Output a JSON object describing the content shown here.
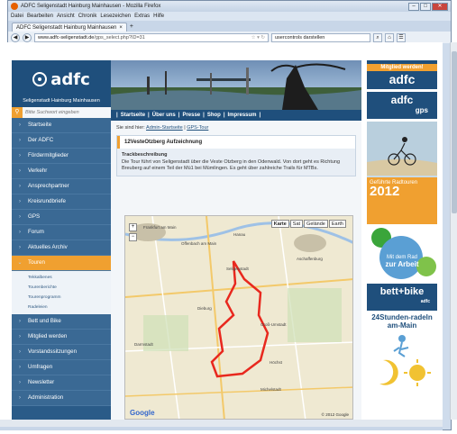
{
  "browser": {
    "window_title": "ADFC Seligenstadt Hainburg Mainhausen - Mozilla Firefox",
    "menu": [
      "Datei",
      "Bearbeiten",
      "Ansicht",
      "Chronik",
      "Lesezeichen",
      "Extras",
      "Hilfe"
    ],
    "tab_title": "ADFC Seligenstadt Hainburg Mainhausen",
    "url_host": "www.adfc-seligenstadt.de",
    "url_path": "/gps_select.php?ID=31",
    "search_placeholder": "usercontrols darstellen"
  },
  "logo": {
    "text": "adfc",
    "subtitle": "Seligenstadt Hainburg Mainhausen"
  },
  "search": {
    "placeholder": "Bitte Suchwort eingeben"
  },
  "sidebar": {
    "items": [
      {
        "label": "Startseite"
      },
      {
        "label": "Der ADFC"
      },
      {
        "label": "Fördermitglieder"
      },
      {
        "label": "Verkehr"
      },
      {
        "label": "Ansprechpartner"
      },
      {
        "label": "Kreisrundbriefe"
      },
      {
        "label": "GPS"
      },
      {
        "label": "Forum"
      },
      {
        "label": "Aktuelles Archiv"
      },
      {
        "label": "Touren"
      },
      {
        "label": "Bett und Bike"
      },
      {
        "label": "Mitglied werden"
      },
      {
        "label": "Vorstandssitzungen"
      },
      {
        "label": "Umfragen"
      },
      {
        "label": "Newsletter"
      },
      {
        "label": "Administration"
      }
    ],
    "sub_items": [
      "Tekkalbenes",
      "Tourenberichte",
      "Tourenprogramm",
      "Radeleien"
    ]
  },
  "topnav": [
    "Startseite",
    "Über uns",
    "Presse",
    "Shop",
    "Impressum"
  ],
  "breadcrumb": {
    "prefix": "Sie sind hier:",
    "link1": "Admin-Startseite",
    "sep": "|",
    "link2": "GPS-Tour"
  },
  "tour": {
    "title": "12VesteOtzberg Aufzeichnung",
    "section": "Trackbeschreibung",
    "description": "Die Tour führt von Seligenstadt über die Veste Otzberg in den Odenwald. Von dort geht es Richtung Breuberg auf einem Teil der Mü1 bei Mümlingen. Es geht über zahlreiche Trails für MTBs."
  },
  "map": {
    "types": [
      "Karte",
      "Sat",
      "Gelände",
      "Earth"
    ],
    "copyright": "© 2012 Google",
    "logo": "Google",
    "zoom_in": "+",
    "zoom_out": "−",
    "places": [
      "Frankfurt am Main",
      "Offenbach am Main",
      "Hanau",
      "Seligenstadt",
      "Dieburg",
      "Groß-Umstadt",
      "Darmstadt",
      "Aschaffenburg",
      "Höchst",
      "Michelstadt"
    ]
  },
  "ads": {
    "mitglied_top": "Mitglied werden!",
    "mitglied_logo": "adfc",
    "gps_logo": "adfc",
    "gps_sub": "gps",
    "radtouren_title": "Geführte Radtouren",
    "radtouren_year": "2012",
    "rad_arbeit_1": "Mit dem Rad",
    "rad_arbeit_2": "zur Arbeit",
    "bettbike": "bett+bike",
    "bettbike_sub": "adfc",
    "stunden": "24Stunden-radeln am-Main"
  },
  "colors": {
    "primary": "#1f4f7c",
    "accent": "#f0a030",
    "nav": "#3a6994",
    "route": "#e8281e"
  }
}
